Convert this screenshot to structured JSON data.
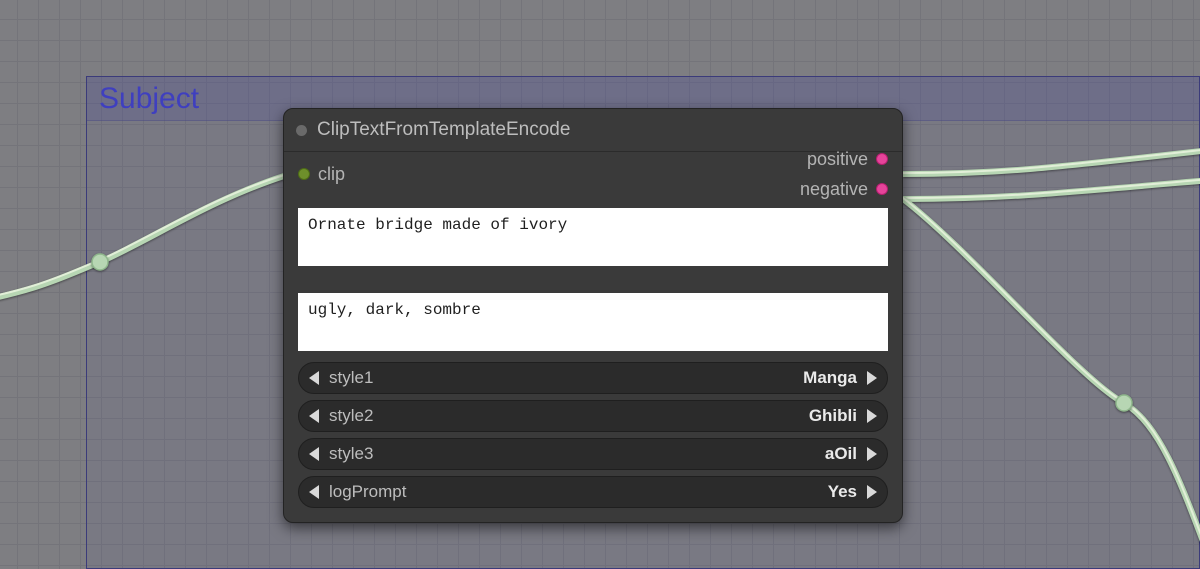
{
  "group": {
    "title": "Subject"
  },
  "node": {
    "title": "ClipTextFromTemplateEncode",
    "ports": {
      "in": {
        "clip": "clip"
      },
      "out": {
        "positive": "positive",
        "negative": "negative"
      }
    },
    "positive_text": "Ornate bridge made of ivory",
    "negative_text": "ugly, dark, sombre",
    "selectors": [
      {
        "label": "style1",
        "value": "Manga"
      },
      {
        "label": "style2",
        "value": "Ghibli"
      },
      {
        "label": "style3",
        "value": "aOil"
      },
      {
        "label": "logPrompt",
        "value": "Yes"
      }
    ]
  }
}
